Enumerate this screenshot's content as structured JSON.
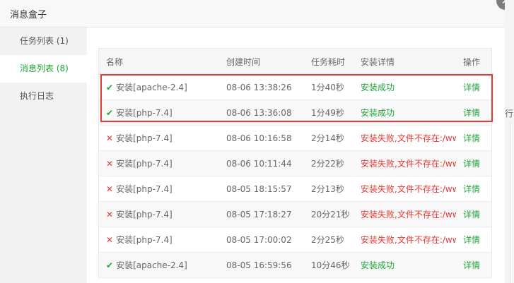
{
  "dialog": {
    "title": "消息盒子",
    "close_symbol": "✕"
  },
  "sidebar": {
    "items": [
      {
        "label": "任务列表 (1)"
      },
      {
        "label": "消息列表 (8)"
      },
      {
        "label": "执行日志"
      }
    ]
  },
  "background": {
    "partial_text": "行"
  },
  "table": {
    "headers": {
      "name": "名称",
      "created": "创建时间",
      "duration": "任务耗时",
      "detail": "安装详情",
      "action": "操作"
    },
    "rows": [
      {
        "status": "ok",
        "name": "安装[apache-2.4]",
        "created": "08-06 13:38:26",
        "duration": "1分40秒",
        "detail": "安装成功",
        "action": "详情"
      },
      {
        "status": "ok",
        "name": "安装[php-7.4]",
        "created": "08-06 13:36:08",
        "duration": "1分49秒",
        "detail": "安装成功",
        "action": "详情"
      },
      {
        "status": "fail",
        "name": "安装[php-7.4]",
        "created": "08-06 10:16:58",
        "duration": "2分14秒",
        "detail": "安装失败,文件不存在:/www",
        "action": "详情"
      },
      {
        "status": "fail",
        "name": "安装[php-7.4]",
        "created": "08-06 10:11:44",
        "duration": "2分22秒",
        "detail": "安装失败,文件不存在:/www",
        "action": "详情"
      },
      {
        "status": "fail",
        "name": "安装[php-7.4]",
        "created": "08-05 18:15:57",
        "duration": "2分13秒",
        "detail": "安装失败,文件不存在:/www",
        "action": "详情"
      },
      {
        "status": "fail",
        "name": "安装[php-7.4]",
        "created": "08-05 17:18:27",
        "duration": "20分21秒",
        "detail": "安装失败,文件不存在:/www",
        "action": "详情"
      },
      {
        "status": "fail",
        "name": "安装[php-7.4]",
        "created": "08-05 17:00:02",
        "duration": "2分25秒",
        "detail": "安装失败,文件不存在:/www",
        "action": "详情"
      },
      {
        "status": "ok",
        "name": "安装[apache-2.4]",
        "created": "08-05 16:59:56",
        "duration": "10分46秒",
        "detail": "安装成功",
        "action": "详情"
      }
    ]
  },
  "icons": {
    "ok": "check-icon",
    "fail": "cross-icon"
  },
  "colors": {
    "success": "#20a53a",
    "error": "#e53935",
    "highlight": "#e53935"
  }
}
